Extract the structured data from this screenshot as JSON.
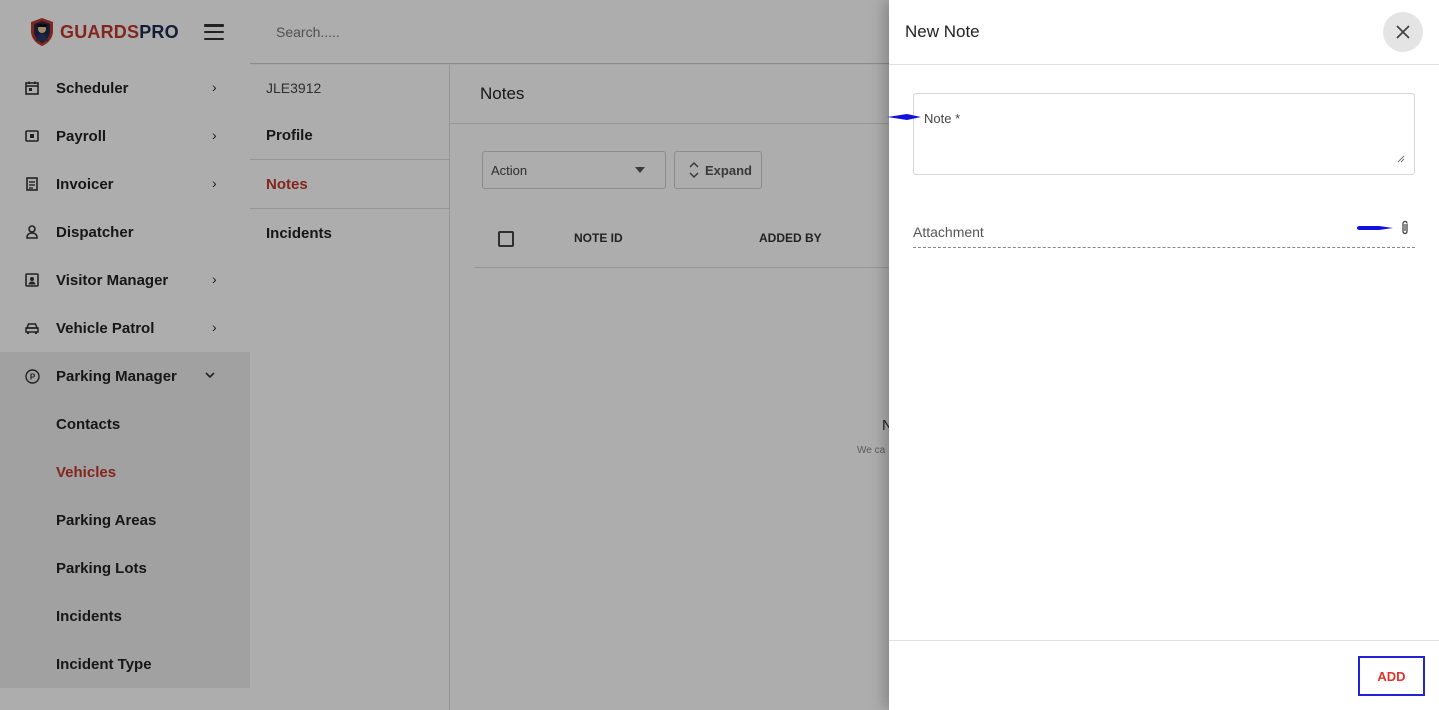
{
  "brand": {
    "part1": "GUARDS",
    "part2": "PRO"
  },
  "search": {
    "placeholder": "Search....."
  },
  "sidebar": {
    "items": [
      {
        "label": "Scheduler",
        "icon": "calendar-icon",
        "has_chevron": true
      },
      {
        "label": "Payroll",
        "icon": "payroll-icon",
        "has_chevron": true
      },
      {
        "label": "Invoicer",
        "icon": "invoice-icon",
        "has_chevron": true
      },
      {
        "label": "Dispatcher",
        "icon": "dispatcher-icon",
        "has_chevron": false
      },
      {
        "label": "Visitor Manager",
        "icon": "visitor-badge-icon",
        "has_chevron": true
      },
      {
        "label": "Vehicle Patrol",
        "icon": "car-icon",
        "has_chevron": true
      },
      {
        "label": "Parking Manager",
        "icon": "parking-icon",
        "expanded": true
      }
    ],
    "sub_items": [
      {
        "label": "Contacts"
      },
      {
        "label": "Vehicles",
        "active": true
      },
      {
        "label": "Parking Areas"
      },
      {
        "label": "Parking Lots"
      },
      {
        "label": "Incidents"
      },
      {
        "label": "Incident Type"
      }
    ]
  },
  "record": {
    "id": "JLE3912",
    "tabs": [
      {
        "label": "Profile"
      },
      {
        "label": "Notes",
        "active": true
      },
      {
        "label": "Incidents"
      }
    ]
  },
  "main": {
    "title": "Notes",
    "action_select": "Action",
    "expand_label": "Expand",
    "columns": [
      "NOTE ID",
      "ADDED BY"
    ],
    "empty_title": "N",
    "empty_sub": "We ca"
  },
  "drawer": {
    "title": "New Note",
    "note_label": "Note *",
    "attachment_label": "Attachment",
    "add_label": "ADD"
  },
  "colors": {
    "brand_red": "#c0392b",
    "brand_navy": "#1f2b4d",
    "annotation_blue": "#1010e0",
    "add_border": "#2323d6"
  }
}
